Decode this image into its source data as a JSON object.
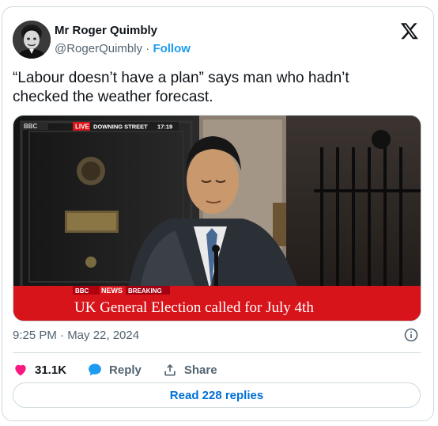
{
  "author": {
    "name": "Mr Roger Quimbly",
    "handle": "@RogerQuimbly",
    "separator": "·",
    "follow_label": "Follow"
  },
  "tweet_text": "“Labour doesn’t have a plan” says man who hadn’t checked the weather forecast.",
  "media": {
    "top_left_logo": "BBC",
    "live_badge": "LIVE",
    "location": "DOWNING STREET",
    "time": "17:19",
    "lower_logo": "BBC",
    "lower_news": "NEWS",
    "breaking": "BREAKING",
    "headline": "UK General Election called for July 4th"
  },
  "timestamp": "9:25 PM · May 22, 2024",
  "actions": {
    "like_count": "31.1K",
    "reply_label": "Reply",
    "share_label": "Share"
  },
  "read_replies_label": "Read 228 replies",
  "colors": {
    "like": "#f91880",
    "reply": "#1d9bf0",
    "link": "#006fd6",
    "bbc_red": "#d7141a"
  },
  "icons": {
    "like": "heart-icon",
    "reply": "reply-bubble-icon",
    "share": "share-icon",
    "info": "info-icon",
    "x_logo": "x-logo-icon"
  }
}
